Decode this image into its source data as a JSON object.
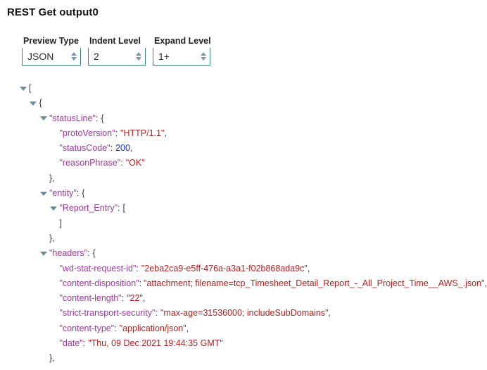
{
  "title": "REST Get output0",
  "controls": [
    {
      "label": "Preview Type",
      "value": "JSON",
      "name": "preview-type"
    },
    {
      "label": "Indent Level",
      "value": "2",
      "name": "indent-level"
    },
    {
      "label": "Expand Level",
      "value": "1+",
      "name": "expand-level"
    }
  ],
  "tree": [
    {
      "depth": 0,
      "toggle": true,
      "punct_open": "["
    },
    {
      "depth": 1,
      "toggle": true,
      "punct_open": "{"
    },
    {
      "depth": 2,
      "toggle": true,
      "key": "\"statusLine\"",
      "colon": ":",
      "punct_open": "{"
    },
    {
      "depth": 3,
      "toggle": false,
      "key": "\"protoVersion\"",
      "colon": ":",
      "value": "\"HTTP/1.1\"",
      "vtype": "string",
      "trail": ","
    },
    {
      "depth": 3,
      "toggle": false,
      "key": "\"statusCode\"",
      "colon": ":",
      "value": "200",
      "vtype": "number",
      "trail": ","
    },
    {
      "depth": 3,
      "toggle": false,
      "key": "\"reasonPhrase\"",
      "colon": ":",
      "value": "\"OK\"",
      "vtype": "string",
      "trail": ""
    },
    {
      "depth": 2,
      "toggle": false,
      "punct_open": "},"
    },
    {
      "depth": 2,
      "toggle": true,
      "key": "\"entity\"",
      "colon": ":",
      "punct_open": "{"
    },
    {
      "depth": 3,
      "toggle": true,
      "key": "\"Report_Entry\"",
      "colon": ":",
      "punct_open": "["
    },
    {
      "depth": 3,
      "toggle": false,
      "punct_open": "]"
    },
    {
      "depth": 2,
      "toggle": false,
      "punct_open": "},"
    },
    {
      "depth": 2,
      "toggle": true,
      "key": "\"headers\"",
      "colon": ":",
      "punct_open": "{"
    },
    {
      "depth": 3,
      "toggle": false,
      "key": "\"wd-stat-request-id\"",
      "colon": ":",
      "value": "\"2eba2ca9-e5ff-476a-a3a1-f02b868ada9c\"",
      "vtype": "string",
      "trail": ","
    },
    {
      "depth": 3,
      "toggle": false,
      "key": "\"content-disposition\"",
      "colon": ":",
      "value": "\"attachment; filename=tcp_Timesheet_Detail_Report_-_All_Project_Time__AWS_.json\"",
      "vtype": "string",
      "trail": ","
    },
    {
      "depth": 3,
      "toggle": false,
      "key": "\"content-length\"",
      "colon": ":",
      "value": "\"22\"",
      "vtype": "string",
      "trail": ","
    },
    {
      "depth": 3,
      "toggle": false,
      "key": "\"strict-transport-security\"",
      "colon": ":",
      "value": "\"max-age=31536000; includeSubDomains\"",
      "vtype": "string",
      "trail": ","
    },
    {
      "depth": 3,
      "toggle": false,
      "key": "\"content-type\"",
      "colon": ":",
      "value": "\"application/json\"",
      "vtype": "string",
      "trail": ","
    },
    {
      "depth": 3,
      "toggle": false,
      "key": "\"date\"",
      "colon": ":",
      "value": "\"Thu, 09 Dec 2021 19:44:35 GMT\"",
      "vtype": "string",
      "trail": ""
    },
    {
      "depth": 2,
      "toggle": false,
      "punct_open": "},"
    }
  ],
  "colors": {
    "key": "#9b3a9b",
    "string_value": "#b02222",
    "number_value": "#1133cc",
    "punctuation": "#3a3a3a",
    "toggle": "#6f8b99",
    "field_border": "#3d7b84",
    "spinner_arrow": "#7d98a6"
  }
}
